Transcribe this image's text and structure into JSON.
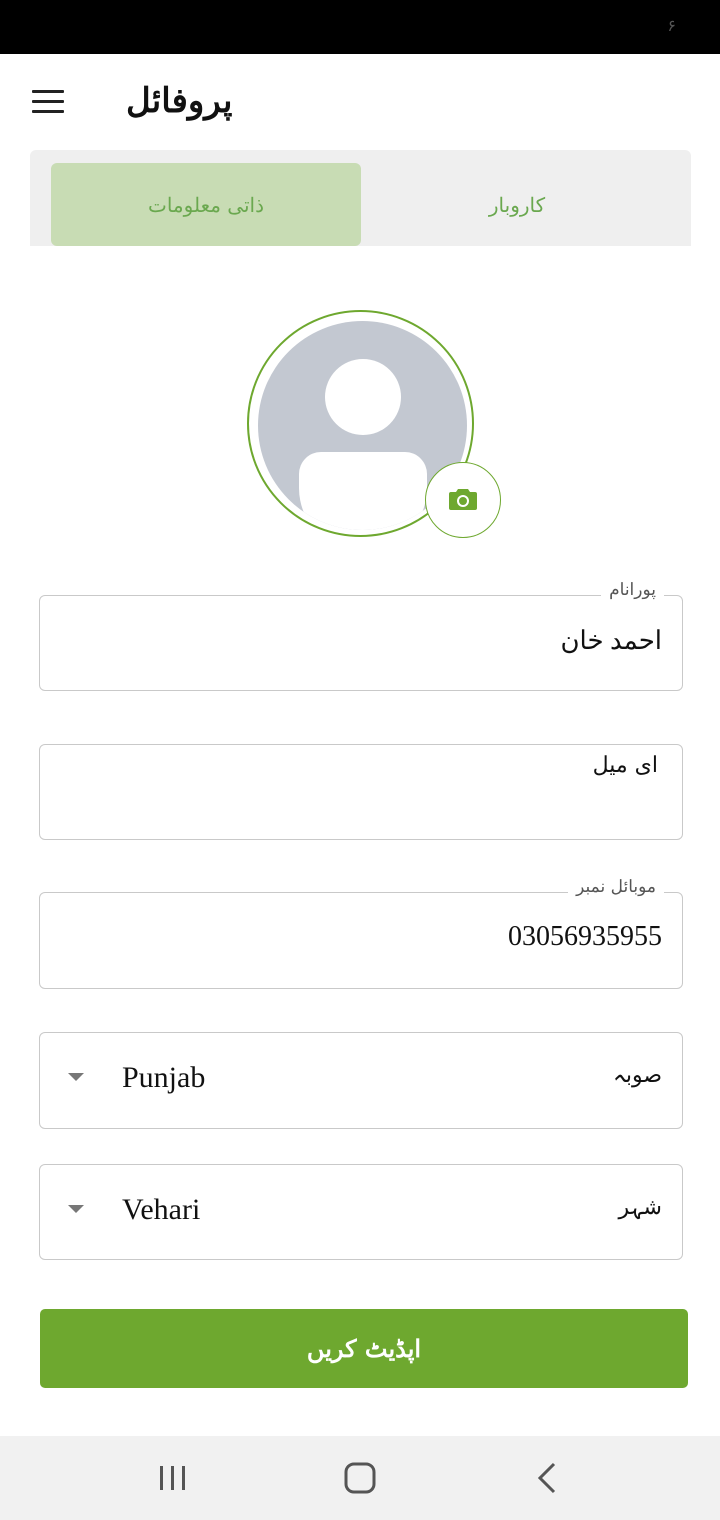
{
  "status_bar": {
    "glyph": "۶"
  },
  "header": {
    "title": "پروفائل"
  },
  "tabs": [
    {
      "label": "ذاتی معلومات",
      "active": true
    },
    {
      "label": "کاروبار",
      "active": false
    }
  ],
  "form": {
    "full_name": {
      "label": "پورانام",
      "value": "احمد خان"
    },
    "email": {
      "placeholder": "ای میل",
      "value": ""
    },
    "mobile": {
      "label": "موبائل نمبر",
      "value": "03056935955"
    },
    "province": {
      "label": "صوبہ",
      "value": "Punjab"
    },
    "city": {
      "label": "شہر",
      "value": "Vehari"
    }
  },
  "update_button": {
    "label": "اپڈیٹ کریں"
  },
  "colors": {
    "accent": "#6ea82f",
    "tab_active_bg": "#c8dcb4",
    "avatar_bg": "#c3c8d1"
  },
  "icons": [
    "menu-icon",
    "camera-icon",
    "avatar-placeholder-icon",
    "chevron-down-icon",
    "recents-icon",
    "home-icon",
    "back-icon"
  ]
}
